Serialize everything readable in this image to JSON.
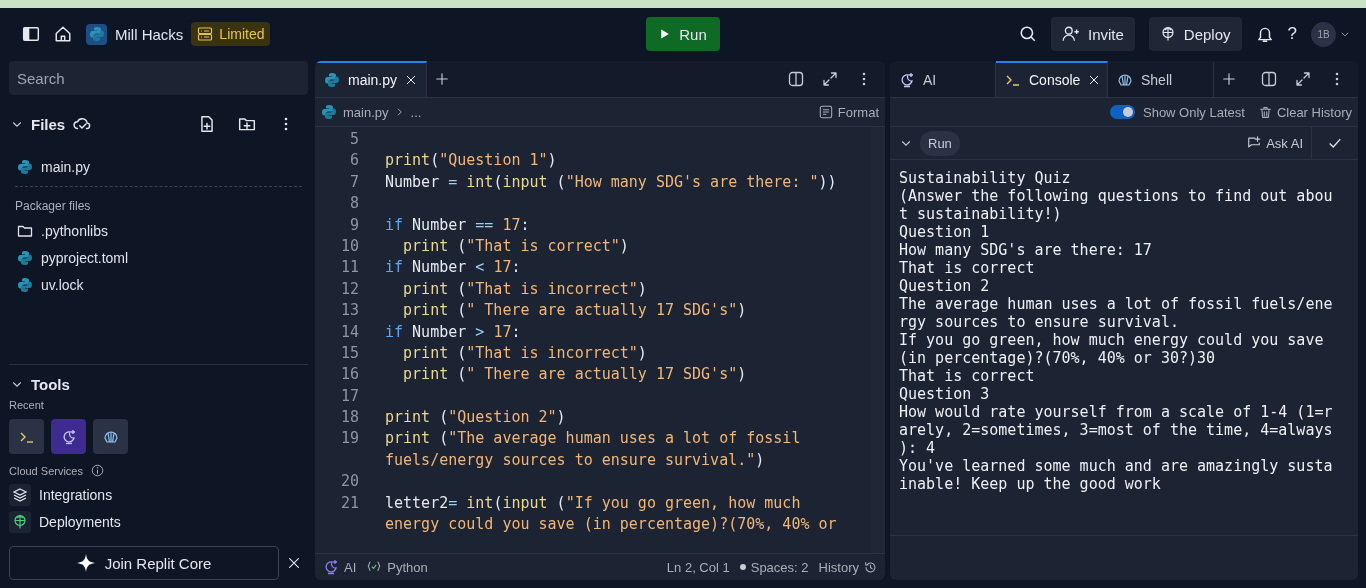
{
  "top_bar": {
    "repl_name": "Mill Hacks",
    "plan_badge": "Limited",
    "run_button": "Run",
    "invite_button": "Invite",
    "deploy_button": "Deploy",
    "help": "?",
    "avatar": "1B"
  },
  "sidebar": {
    "search": {
      "placeholder": "Search"
    },
    "files_title": "Files",
    "files": [
      {
        "name": "main.py",
        "kind": "python"
      }
    ],
    "packager_title": "Packager files",
    "packager_files": [
      {
        "name": ".pythonlibs",
        "kind": "folder"
      },
      {
        "name": "pyproject.toml",
        "kind": "python"
      },
      {
        "name": "uv.lock",
        "kind": "python"
      }
    ],
    "tools_title": "Tools",
    "recent_label": "Recent",
    "recent_tools": [
      {
        "kind": "console"
      },
      {
        "kind": "ai"
      },
      {
        "kind": "shell"
      }
    ],
    "cloud_label": "Cloud Services",
    "cloud_services": [
      {
        "name": "Integrations",
        "kind": "layers"
      },
      {
        "name": "Deployments",
        "kind": "deploy"
      }
    ],
    "promo_button": "Join Replit Core"
  },
  "editor": {
    "tabs": [
      {
        "label": "main.py",
        "selected": true
      }
    ],
    "breadcrumb": [
      "main.py",
      "..."
    ],
    "format_button": "Format",
    "lines": [
      {
        "number": "5"
      },
      {
        "number": "6",
        "segments": [
          {
            "kind": "func",
            "text": "print"
          },
          {
            "kind": "plain",
            "text": "("
          },
          {
            "kind": "string",
            "text": "\"Question 1\""
          },
          {
            "kind": "plain",
            "text": ")"
          }
        ]
      },
      {
        "number": "7",
        "segments": [
          {
            "kind": "plain",
            "text": "Number "
          },
          {
            "kind": "operator",
            "text": "= "
          },
          {
            "kind": "func",
            "text": "int"
          },
          {
            "kind": "plain",
            "text": "("
          },
          {
            "kind": "func",
            "text": "input"
          },
          {
            "kind": "plain",
            "text": " ("
          },
          {
            "kind": "string",
            "text": "\"How many SDG's are there: \""
          },
          {
            "kind": "plain",
            "text": "))"
          }
        ]
      },
      {
        "number": "8"
      },
      {
        "number": "9",
        "segments": [
          {
            "kind": "keyword",
            "text": "if"
          },
          {
            "kind": "plain",
            "text": " Number "
          },
          {
            "kind": "operator",
            "text": "== "
          },
          {
            "kind": "number",
            "text": "17"
          },
          {
            "kind": "plain",
            "text": ":"
          }
        ]
      },
      {
        "number": "10",
        "indented": true,
        "segments": [
          {
            "kind": "func",
            "text": "print"
          },
          {
            "kind": "plain",
            "text": " ("
          },
          {
            "kind": "string",
            "text": "\"That is correct\""
          },
          {
            "kind": "plain",
            "text": ")"
          }
        ]
      },
      {
        "number": "11",
        "segments": [
          {
            "kind": "keyword",
            "text": "if"
          },
          {
            "kind": "plain",
            "text": " Number "
          },
          {
            "kind": "operator",
            "text": "< "
          },
          {
            "kind": "number",
            "text": "17"
          },
          {
            "kind": "plain",
            "text": ":"
          }
        ]
      },
      {
        "number": "12",
        "indented": true,
        "segments": [
          {
            "kind": "func",
            "text": "print"
          },
          {
            "kind": "plain",
            "text": " ("
          },
          {
            "kind": "string",
            "text": "\"That is incorrect\""
          },
          {
            "kind": "plain",
            "text": ")"
          }
        ]
      },
      {
        "number": "13",
        "indented": true,
        "segments": [
          {
            "kind": "func",
            "text": "print"
          },
          {
            "kind": "plain",
            "text": " ("
          },
          {
            "kind": "string",
            "text": "\" There are actually 17 SDG's\""
          },
          {
            "kind": "plain",
            "text": ")"
          }
        ]
      },
      {
        "number": "14",
        "segments": [
          {
            "kind": "keyword",
            "text": "if"
          },
          {
            "kind": "plain",
            "text": " Number "
          },
          {
            "kind": "operator",
            "text": "> "
          },
          {
            "kind": "number",
            "text": "17"
          },
          {
            "kind": "plain",
            "text": ":"
          }
        ]
      },
      {
        "number": "15",
        "indented": true,
        "segments": [
          {
            "kind": "func",
            "text": "print"
          },
          {
            "kind": "plain",
            "text": " ("
          },
          {
            "kind": "string",
            "text": "\"That is incorrect\""
          },
          {
            "kind": "plain",
            "text": ")"
          }
        ]
      },
      {
        "number": "16",
        "indented": true,
        "segments": [
          {
            "kind": "func",
            "text": "print"
          },
          {
            "kind": "plain",
            "text": " ("
          },
          {
            "kind": "string",
            "text": "\" There are actually 17 SDG's\""
          },
          {
            "kind": "plain",
            "text": ")"
          }
        ]
      },
      {
        "number": "17"
      },
      {
        "number": "18",
        "segments": [
          {
            "kind": "func",
            "text": "print"
          },
          {
            "kind": "plain",
            "text": " ("
          },
          {
            "kind": "string",
            "text": "\"Question 2\""
          },
          {
            "kind": "plain",
            "text": ")"
          }
        ]
      },
      {
        "number": "19",
        "segments": [
          {
            "kind": "func",
            "text": "print"
          },
          {
            "kind": "plain",
            "text": " ("
          },
          {
            "kind": "string",
            "text": "\"The average human uses a lot of fossil"
          }
        ],
        "wrapped_segments": [
          {
            "kind": "string",
            "text": "fuels/energy sources to ensure survival.\""
          },
          {
            "kind": "plain",
            "text": ")"
          }
        ]
      },
      {
        "number": "20"
      },
      {
        "number": "21",
        "segments": [
          {
            "kind": "plain",
            "text": "letter2"
          },
          {
            "kind": "operator",
            "text": "= "
          },
          {
            "kind": "func",
            "text": "int"
          },
          {
            "kind": "plain",
            "text": "("
          },
          {
            "kind": "func",
            "text": "input"
          },
          {
            "kind": "plain",
            "text": " ("
          },
          {
            "kind": "string",
            "text": "\"If you go green, how much"
          }
        ],
        "wrapped_segments": [
          {
            "kind": "string",
            "text": "energy could you save (in percentage)?(70%, 40% or"
          }
        ]
      }
    ],
    "status_bar": {
      "ai": "AI",
      "language": "Python",
      "position": "Ln 2, Col 1",
      "spaces": "Spaces: 2",
      "history": "History"
    }
  },
  "console_panel": {
    "tabs": [
      {
        "label": "AI",
        "kind": "ai",
        "selected": false
      },
      {
        "label": "Console",
        "kind": "console",
        "selected": true
      },
      {
        "label": "Shell",
        "kind": "shell",
        "selected": false
      }
    ],
    "show_only_latest": {
      "label": "Show Only Latest",
      "on": true
    },
    "clear_history": "Clear History",
    "run_label": "Run",
    "ask_ai": "Ask AI",
    "output": [
      "Sustainability Quiz",
      "(Answer the following questions to find out abou",
      "t sustainability!)",
      "Question 1",
      "How many SDG's are there: 17",
      "That is correct",
      "Question 2",
      "The average human uses a lot of fossil fuels/ene",
      "rgy sources to ensure survival.",
      "If you go green, how much energy could you save",
      "(in percentage)?(70%, 40% or 30?)30",
      "That is correct",
      "Question 3",
      "How would rate yourself from a scale of 1-4 (1=r",
      "arely, 2=sometimes, 3=most of the time, 4=always",
      "): 4",
      "You've learned some much and are amazingly susta",
      "inable! Keep up the good work"
    ]
  }
}
